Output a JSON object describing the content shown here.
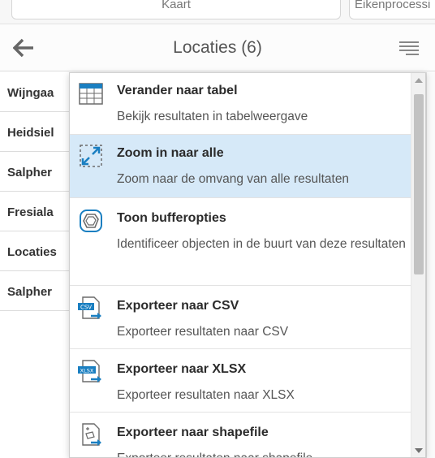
{
  "top_controls": {
    "left_field": "Kaart",
    "right_field": "Eikenprocessi"
  },
  "header": {
    "title": "Locaties (6)",
    "back_icon": "back-arrow-icon",
    "menu_icon": "hamburger-menu-icon"
  },
  "results_list": {
    "items": [
      {
        "label": "Wijngaa"
      },
      {
        "label": "Heidsiel"
      },
      {
        "label": "Salpher"
      },
      {
        "label": "Fresiala"
      },
      {
        "label": "Locaties"
      },
      {
        "label": "Salpher"
      }
    ]
  },
  "context_menu": {
    "items": [
      {
        "title": "Verander naar tabel",
        "description": "Bekijk resultaten in tabelweergave",
        "icon": "table-icon"
      },
      {
        "title": "Zoom in naar alle",
        "description": "Zoom naar de omvang van alle resultaten",
        "icon": "zoom-extent-icon",
        "active": true
      },
      {
        "title": "Toon bufferopties",
        "description": "Identificeer objecten in de buurt van deze resultaten",
        "icon": "buffer-icon"
      },
      {
        "title": "Exporteer naar CSV",
        "description": "Exporteer resultaten naar CSV",
        "icon": "export-csv-icon",
        "badge": "CSV"
      },
      {
        "title": "Exporteer naar XLSX",
        "description": "Exporteer resultaten naar XLSX",
        "icon": "export-xlsx-icon",
        "badge": "XLSX"
      },
      {
        "title": "Exporteer naar shapefile",
        "description": "Exporteer resultaten naar shapefile",
        "icon": "export-shapefile-icon"
      }
    ]
  },
  "colors": {
    "active_row": "#d6e9f8",
    "icon_blue": "#1a7fc1"
  }
}
